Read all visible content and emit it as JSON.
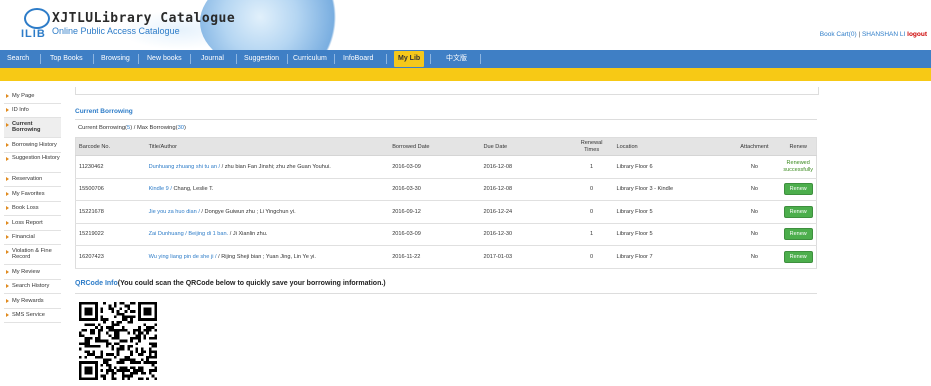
{
  "header": {
    "logo_text": "ILIB",
    "title": "XJTLULibrary Catalogue",
    "subtitle": "Online Public Access Catalogue",
    "cart": "Book Cart(0)",
    "separator": "|",
    "user": "SHANSHAN LI",
    "logout": "logout"
  },
  "nav": {
    "items": [
      "Search",
      "Top Books",
      "Browsing",
      "New books",
      "Journal",
      "Suggestion",
      "Curriculum",
      "InfoBoard",
      "My Lib",
      "中文版"
    ],
    "active": "My Lib"
  },
  "sidebar": {
    "items": [
      "My Page",
      "ID Info",
      "Current Borrowing",
      "Borrowing History",
      "Suggestion History",
      "Reservation",
      "My Favorites",
      "Book Loss",
      "Loss Report",
      "Financial",
      "Violation & Fine Record",
      "My Review",
      "Search History",
      "My Rewards",
      "SMS Service"
    ],
    "active": "Current Borrowing"
  },
  "main": {
    "section_title": "Current Borrowing",
    "summary": {
      "label1": "Current Borrowing(",
      "current": "5",
      "label2": ") / Max Borrowing(",
      "max": "30",
      "label3": ")"
    },
    "table": {
      "headers": [
        "Barcode No.",
        "Title/Author",
        "Borrowed Date",
        "Due Date",
        "Renewal Times",
        "Location",
        "Attachment",
        "Renew"
      ],
      "rows": [
        {
          "barcode": "11230462",
          "title": "Dunhuang zhuang shi tu an /",
          "author": " / zhu bian Fan Jinshi; zhu zhe Guan Youhui.",
          "borrowed": "2016-03-09",
          "due": "2016-12-08",
          "renewals": "1",
          "location": "Library Floor 6",
          "attachment": "No",
          "renew": "Renewed successfully",
          "renew_state": "done"
        },
        {
          "barcode": "15500706",
          "title": "Kindle 9 /",
          "author": " Chang, Leslie T.",
          "borrowed": "2016-03-30",
          "due": "2016-12-08",
          "renewals": "0",
          "location": "Library Floor 3 - Kindle",
          "attachment": "No",
          "renew": "Renew",
          "renew_state": "button"
        },
        {
          "barcode": "15221678",
          "title": "Jie you za huo dian /",
          "author": " / Dongye Guiwun zhu ; Li Yingchun yi.",
          "borrowed": "2016-09-12",
          "due": "2016-12-24",
          "renewals": "0",
          "location": "Library Floor 5",
          "attachment": "No",
          "renew": "Renew",
          "renew_state": "button"
        },
        {
          "barcode": "15219022",
          "title": "Zai Dunhuang / Beijing di 1 ban.",
          "author": " / Ji Xianlin zhu.",
          "borrowed": "2016-03-09",
          "due": "2016-12-30",
          "renewals": "1",
          "location": "Library Floor 5",
          "attachment": "No",
          "renew": "Renew",
          "renew_state": "button"
        },
        {
          "barcode": "16207423",
          "title": "Wu ying liang pin de she ji /",
          "author": " / Rijing Sheji bian ; Yuan Jing, Lin Ye yi.",
          "borrowed": "2016-11-22",
          "due": "2017-01-03",
          "renewals": "0",
          "location": "Library Floor 7",
          "attachment": "No",
          "renew": "Renew",
          "renew_state": "button"
        }
      ]
    },
    "qr": {
      "title_blue": "QRCode Info",
      "title_rest": "(You could scan the QRCode below to quickly save your borrowing information.)"
    }
  },
  "colors": {
    "nav_blue": "#3f7fc5",
    "accent_yellow": "#f7c915",
    "link_blue": "#2d7cc8",
    "renew_green": "#4cae4c",
    "logout_red": "#cc0000"
  }
}
